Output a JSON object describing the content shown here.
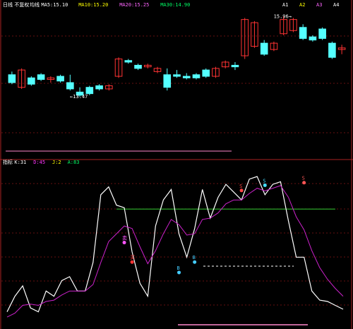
{
  "chart_data": [
    {
      "type": "candlestick",
      "panel": "main",
      "header_texts": [
        {
          "text": "日线",
          "color": "#ffffff"
        },
        {
          "text": "不复权",
          "color": "#ffffff"
        },
        {
          "text": "均线",
          "color": "#ffffff"
        },
        {
          "text": "MA5:15.10",
          "color": "#ffffff"
        },
        {
          "text": "MA10:15.20",
          "color": "#ffff00"
        },
        {
          "text": "MA20:15.25",
          "color": "#ff66ff"
        },
        {
          "text": "MA30:14.90",
          "color": "#00ff66"
        }
      ],
      "header_right": [
        {
          "text": "A1",
          "color": "#ffffff"
        },
        {
          "text": "A2",
          "color": "#ffff00"
        },
        {
          "text": "A3",
          "color": "#ff66ff"
        },
        {
          "text": "A4",
          "color": "#ffffff"
        }
      ],
      "ylim": [
        11.5,
        16.2
      ],
      "candles": [
        {
          "o": 14.1,
          "h": 14.2,
          "l": 13.8,
          "c": 13.85,
          "up": false
        },
        {
          "o": 13.7,
          "h": 14.3,
          "l": 13.65,
          "c": 14.25,
          "up": true
        },
        {
          "o": 14.0,
          "h": 14.05,
          "l": 13.75,
          "c": 13.8,
          "up": false
        },
        {
          "o": 14.1,
          "h": 14.15,
          "l": 13.9,
          "c": 13.95,
          "up": false
        },
        {
          "o": 13.95,
          "h": 14.05,
          "l": 13.85,
          "c": 14.0,
          "up": true
        },
        {
          "o": 14.05,
          "h": 14.1,
          "l": 13.85,
          "c": 13.9,
          "up": false
        },
        {
          "o": 13.85,
          "h": 14.1,
          "l": 13.6,
          "c": 13.65,
          "up": false
        },
        {
          "o": 13.55,
          "h": 13.7,
          "l": 13.4,
          "c": 13.45,
          "up": false
        },
        {
          "o": 13.5,
          "h": 13.75,
          "l": 13.45,
          "c": 13.7,
          "up": false
        },
        {
          "o": 13.75,
          "h": 13.8,
          "l": 13.6,
          "c": 13.65,
          "up": false
        },
        {
          "o": 13.65,
          "h": 13.8,
          "l": 13.6,
          "c": 13.75,
          "up": true
        },
        {
          "o": 14.05,
          "h": 14.65,
          "l": 14.0,
          "c": 14.6,
          "up": true
        },
        {
          "o": 14.55,
          "h": 14.6,
          "l": 14.45,
          "c": 14.5,
          "up": false
        },
        {
          "o": 14.4,
          "h": 14.45,
          "l": 14.25,
          "c": 14.3,
          "up": false
        },
        {
          "o": 14.4,
          "h": 14.45,
          "l": 14.3,
          "c": 14.35,
          "up": true
        },
        {
          "o": 14.3,
          "h": 14.35,
          "l": 14.15,
          "c": 14.2,
          "up": true
        },
        {
          "o": 14.1,
          "h": 14.3,
          "l": 13.6,
          "c": 13.7,
          "up": false
        },
        {
          "o": 14.1,
          "h": 14.25,
          "l": 14.0,
          "c": 14.05,
          "up": false
        },
        {
          "o": 14.05,
          "h": 14.15,
          "l": 13.95,
          "c": 14.0,
          "up": false
        },
        {
          "o": 14.0,
          "h": 14.15,
          "l": 13.95,
          "c": 14.1,
          "up": false
        },
        {
          "o": 14.25,
          "h": 14.3,
          "l": 14.0,
          "c": 14.05,
          "up": false
        },
        {
          "o": 14.05,
          "h": 14.35,
          "l": 14.0,
          "c": 14.3,
          "up": true
        },
        {
          "o": 14.35,
          "h": 14.55,
          "l": 14.3,
          "c": 14.5,
          "up": true
        },
        {
          "o": 14.35,
          "h": 14.5,
          "l": 14.25,
          "c": 14.4,
          "up": false
        },
        {
          "o": 14.7,
          "h": 15.9,
          "l": 14.6,
          "c": 15.85,
          "up": true
        },
        {
          "o": 15.0,
          "h": 15.8,
          "l": 14.95,
          "c": 15.75,
          "up": true
        },
        {
          "o": 15.1,
          "h": 15.2,
          "l": 14.7,
          "c": 14.75,
          "up": false
        },
        {
          "o": 14.9,
          "h": 15.15,
          "l": 14.85,
          "c": 15.1,
          "up": true
        },
        {
          "o": 15.4,
          "h": 15.95,
          "l": 15.35,
          "c": 15.85,
          "up": true
        },
        {
          "o": 15.5,
          "h": 15.9,
          "l": 15.45,
          "c": 15.85,
          "up": true
        },
        {
          "o": 15.6,
          "h": 15.7,
          "l": 15.2,
          "c": 15.25,
          "up": false
        },
        {
          "o": 15.3,
          "h": 15.35,
          "l": 15.15,
          "c": 15.2,
          "up": false
        },
        {
          "o": 15.55,
          "h": 15.6,
          "l": 15.2,
          "c": 15.25,
          "up": false
        },
        {
          "o": 15.1,
          "h": 15.15,
          "l": 14.6,
          "c": 14.65,
          "up": false
        },
        {
          "o": 14.9,
          "h": 15.05,
          "l": 14.75,
          "c": 14.95,
          "up": true
        }
      ],
      "annotations": [
        {
          "text": "←13.47",
          "candle": 7,
          "price": 13.42,
          "color": "#ffffff"
        },
        {
          "text": "15.96→",
          "candle": 28,
          "price": 15.97,
          "color": "#ffffff"
        }
      ]
    },
    {
      "type": "line",
      "panel": "indicator",
      "header_texts": [
        {
          "text": "指标",
          "color": "#ffffff"
        },
        {
          "text": "K:31",
          "color": "#ffffff"
        },
        {
          "text": "D:45",
          "color": "#ff33ff"
        },
        {
          "text": "J:2",
          "color": "#ffff00"
        },
        {
          "text": "A:83",
          "color": "#00ff66"
        }
      ],
      "ylim": [
        -5,
        110
      ],
      "hlines": [
        {
          "y": 85,
          "color": "#33cc33"
        }
      ],
      "series": [
        {
          "color": "#ffffff",
          "values": [
            6,
            18,
            26,
            9,
            6,
            22,
            18,
            30,
            33,
            22,
            22,
            44,
            96,
            102,
            88,
            86,
            52,
            28,
            18,
            72,
            92,
            100,
            66,
            48,
            70,
            100,
            78,
            94,
            104,
            98,
            92,
            108,
            110,
            96,
            104,
            106,
            76,
            48,
            48,
            22,
            15,
            14,
            11,
            8
          ]
        },
        {
          "color": "#cc22cc",
          "values": [
            2,
            5,
            11,
            12,
            11,
            14,
            15,
            19,
            22,
            22,
            22,
            27,
            44,
            60,
            66,
            72,
            70,
            56,
            43,
            53,
            66,
            77,
            73,
            65,
            66,
            77,
            78,
            82,
            89,
            92,
            92,
            97,
            101,
            99,
            101,
            103,
            94,
            79,
            69,
            53,
            40,
            31,
            24,
            18
          ]
        }
      ],
      "markers": [
        {
          "x": 15,
          "y": 56,
          "label": "卖",
          "color": "#ff55ff"
        },
        {
          "x": 16,
          "y": 41,
          "label": "买",
          "color": "#ff3333"
        },
        {
          "x": 22,
          "y": 33,
          "label": "B",
          "color": "#44ccff"
        },
        {
          "x": 24,
          "y": 41,
          "label": "B",
          "color": "#44ccff"
        },
        {
          "x": 30,
          "y": 96,
          "label": "S",
          "color": "#ff4444"
        },
        {
          "x": 33,
          "y": 100,
          "label": "S",
          "color": "#44ddff"
        },
        {
          "x": 38,
          "y": 102,
          "label": "S",
          "color": "#ff5555"
        }
      ]
    }
  ]
}
